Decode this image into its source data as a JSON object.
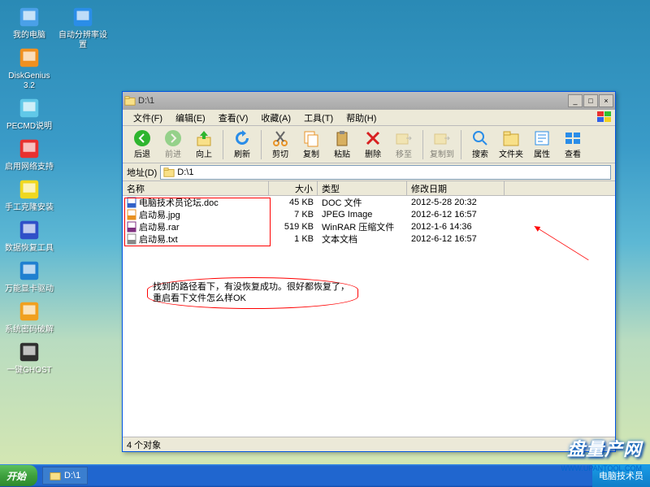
{
  "desktop_icons_col1": [
    {
      "label": "我的电脑",
      "glyph": "computer"
    },
    {
      "label": "DiskGenius 3.2",
      "glyph": "dg"
    },
    {
      "label": "PECMD说明",
      "glyph": "pecmd"
    },
    {
      "label": "启用网络支持",
      "glyph": "net"
    },
    {
      "label": "手工克隆安装",
      "glyph": "clone"
    },
    {
      "label": "数据恢复工具",
      "glyph": "d"
    },
    {
      "label": "万能显卡驱动",
      "glyph": "display"
    },
    {
      "label": "系统密码破解",
      "glyph": "key"
    },
    {
      "label": "一键GHOST",
      "glyph": "ghost"
    }
  ],
  "desktop_icons_col2": [
    {
      "label": "自动分辨率设置",
      "glyph": "res"
    }
  ],
  "window": {
    "title": "D:\\1",
    "menu": [
      "文件(F)",
      "编辑(E)",
      "查看(V)",
      "收藏(A)",
      "工具(T)",
      "帮助(H)"
    ],
    "toolbar": [
      {
        "label": "后退",
        "color": "#2eb52e",
        "kind": "back"
      },
      {
        "label": "前进",
        "color": "#2eb52e",
        "kind": "fwd",
        "disabled": true
      },
      {
        "label": "向上",
        "color": "#2eb52e",
        "kind": "up"
      },
      {
        "label": "刷新",
        "color": "#2a8de8",
        "kind": "refresh",
        "sep": true
      },
      {
        "label": "剪切",
        "color": "#e89428",
        "kind": "cut"
      },
      {
        "label": "复制",
        "color": "#e89428",
        "kind": "copy"
      },
      {
        "label": "粘贴",
        "color": "#e89428",
        "kind": "paste"
      },
      {
        "label": "删除",
        "color": "#d82020",
        "kind": "delete"
      },
      {
        "label": "移至",
        "color": "#888",
        "kind": "moveto",
        "disabled": true
      },
      {
        "label": "复制到",
        "color": "#888",
        "kind": "copyto",
        "disabled": true,
        "sep": true
      },
      {
        "label": "搜索",
        "color": "#2a8de8",
        "kind": "search"
      },
      {
        "label": "文件夹",
        "color": "#e8c860",
        "kind": "folders"
      },
      {
        "label": "属性",
        "color": "#2a8de8",
        "kind": "props"
      },
      {
        "label": "查看",
        "color": "#2a8de8",
        "kind": "view"
      }
    ],
    "addr_label": "地址(D)",
    "addr_value": "D:\\1",
    "columns": {
      "name": "名称",
      "size": "大小",
      "type": "类型",
      "date": "修改日期"
    },
    "files": [
      {
        "name": "电脑技术员论坛.doc",
        "size": "45 KB",
        "type": "DOC 文件",
        "date": "2012-5-28 20:32",
        "icon": "doc"
      },
      {
        "name": "启动易.jpg",
        "size": "7 KB",
        "type": "JPEG Image",
        "date": "2012-6-12 16:57",
        "icon": "jpg"
      },
      {
        "name": "启动易.rar",
        "size": "519 KB",
        "type": "WinRAR 压缩文件",
        "date": "2012-1-6 14:36",
        "icon": "rar"
      },
      {
        "name": "启动易.txt",
        "size": "1 KB",
        "type": "文本文档",
        "date": "2012-6-12 16:57",
        "icon": "txt"
      }
    ],
    "note": "找到的路径看下，有没恢复成功。很好都恢复了，重启看下文件怎么样OK",
    "status": "4 个对象"
  },
  "taskbar": {
    "start": "开始",
    "item": "D:\\1",
    "tray_text": "电脑技术员"
  },
  "watermark": "盘量产网",
  "watermark_sub": "WWW.UPANTOOL.COM"
}
